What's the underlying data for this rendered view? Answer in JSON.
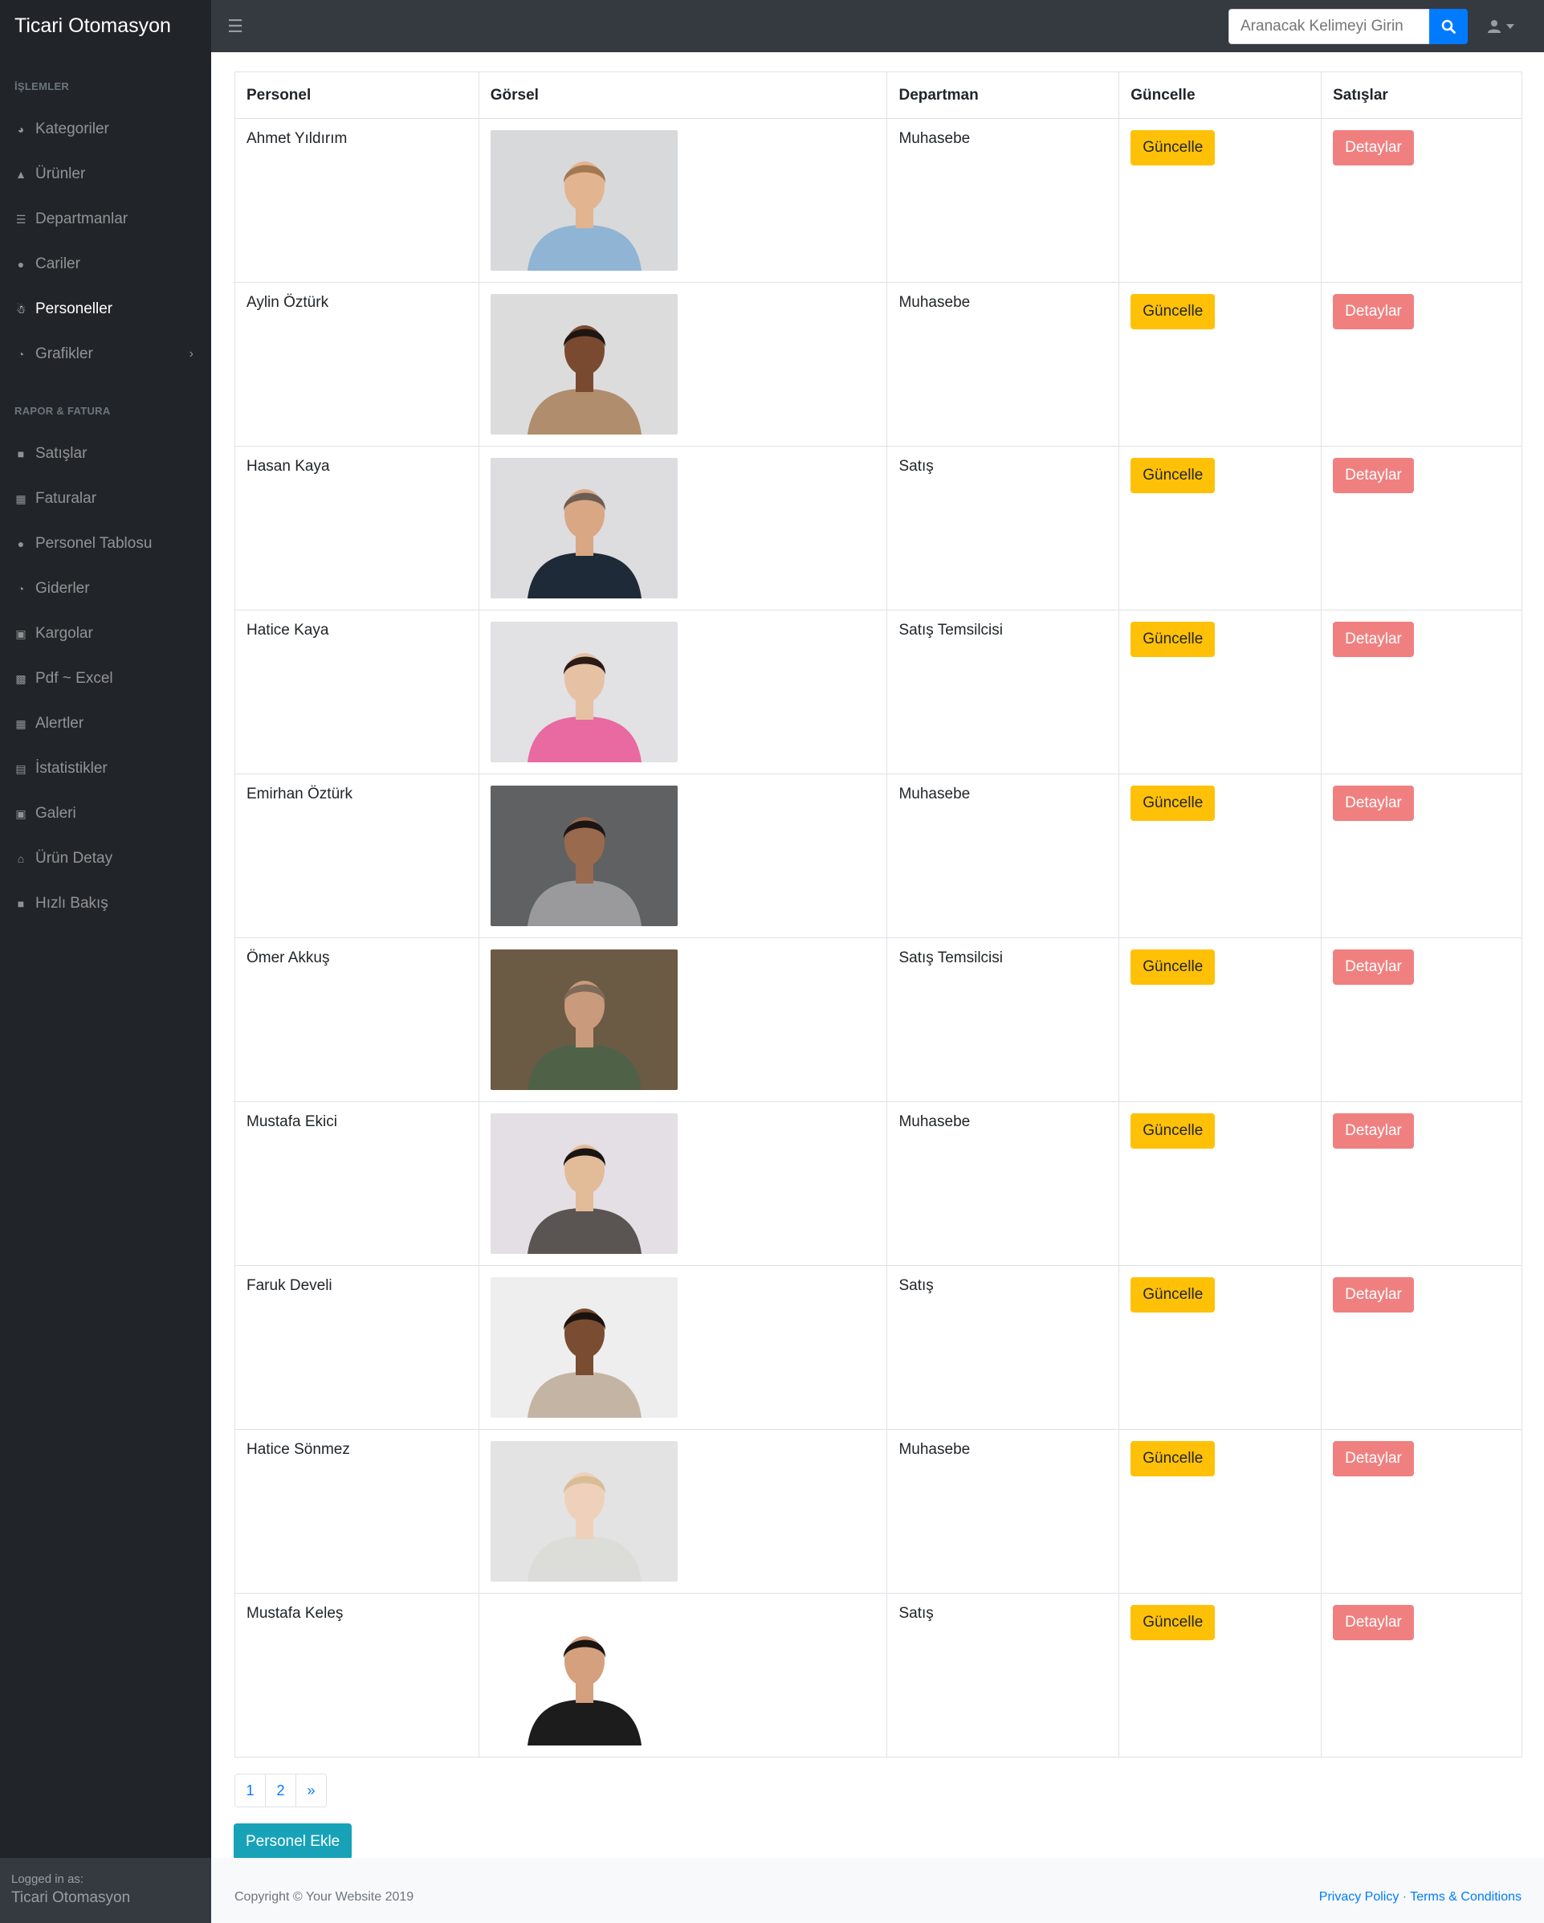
{
  "app": {
    "brand": "Ticari Otomasyon"
  },
  "search": {
    "placeholder": "Aranacak Kelimeyi Girin"
  },
  "sidebar": {
    "headings": [
      "İŞLEMLER",
      "RAPOR & FATURA"
    ],
    "items": [
      {
        "label": "Kategoriler",
        "icon": "tachometer-icon"
      },
      {
        "label": "Ürünler",
        "icon": "flask-icon"
      },
      {
        "label": "Departmanlar",
        "icon": "bars-icon"
      },
      {
        "label": "Cariler",
        "icon": "user-icon"
      },
      {
        "label": "Personeller",
        "icon": "child-icon"
      },
      {
        "label": "Grafikler",
        "icon": "chart-pie-icon"
      }
    ],
    "items2": [
      {
        "label": "Satışlar",
        "icon": "car-icon"
      },
      {
        "label": "Faturalar",
        "icon": "calendar-icon"
      },
      {
        "label": "Personel Tablosu",
        "icon": "users-icon"
      },
      {
        "label": "Giderler",
        "icon": "chart-pie-icon"
      },
      {
        "label": "Kargolar",
        "icon": "gift-icon"
      },
      {
        "label": "Pdf ~ Excel",
        "icon": "print-icon"
      },
      {
        "label": "Alertler",
        "icon": "calendar-icon"
      },
      {
        "label": "İstatistikler",
        "icon": "database-icon"
      },
      {
        "label": "Galeri",
        "icon": "image-icon"
      },
      {
        "label": "Ürün Detay",
        "icon": "university-icon"
      },
      {
        "label": "Hızlı Bakış",
        "icon": "car-icon"
      }
    ],
    "footer": {
      "logged_in_label": "Logged in as:",
      "user": "Ticari Otomasyon"
    }
  },
  "table": {
    "headers": [
      "Personel",
      "Görsel",
      "Departman",
      "Güncelle",
      "Satışlar"
    ],
    "rows": [
      {
        "name": "Ahmet Yıldırım",
        "department": "Muhasebe",
        "update": "Güncelle",
        "details": "Detaylar",
        "bg": "#d8d9db",
        "shirt": "#8fb4d4",
        "skin": "#e2b48f",
        "hair": "#a37752"
      },
      {
        "name": "Aylin Öztürk",
        "department": "Muhasebe",
        "update": "Güncelle",
        "details": "Detaylar",
        "bg": "#dcdcdc",
        "shirt": "#b08d6c",
        "skin": "#7a4a30",
        "hair": "#1e1611"
      },
      {
        "name": "Hasan Kaya",
        "department": "Satış",
        "update": "Güncelle",
        "details": "Detaylar",
        "bg": "#dddcdf",
        "shirt": "#1f2a38",
        "skin": "#d9a784",
        "hair": "#6d5c52"
      },
      {
        "name": "Hatice Kaya",
        "department": "Satış Temsilcisi",
        "update": "Güncelle",
        "details": "Detaylar",
        "bg": "#e2e1e4",
        "shirt": "#e86aa0",
        "skin": "#e7c1a4",
        "hair": "#2b1b16"
      },
      {
        "name": "Emirhan Öztürk",
        "department": "Muhasebe",
        "update": "Güncelle",
        "details": "Detaylar",
        "bg": "#5f6163",
        "shirt": "#9a9a9c",
        "skin": "#9a6a4e",
        "hair": "#1b1614"
      },
      {
        "name": "Ömer Akkuş",
        "department": "Satış Temsilcisi",
        "update": "Güncelle",
        "details": "Detaylar",
        "bg": "#6b5a44",
        "shirt": "#4f6247",
        "skin": "#c99a7b",
        "hair": "#7d6a58"
      },
      {
        "name": "Mustafa Ekici",
        "department": "Muhasebe",
        "update": "Güncelle",
        "details": "Detaylar",
        "bg": "#e4dfe4",
        "shirt": "#5a5452",
        "skin": "#e2bb98",
        "hair": "#1a1514"
      },
      {
        "name": "Faruk Develi",
        "department": "Satış",
        "update": "Güncelle",
        "details": "Detaylar",
        "bg": "#eeeeee",
        "shirt": "#c4b4a4",
        "skin": "#7a4c31",
        "hair": "#1a120e"
      },
      {
        "name": "Hatice Sönmez",
        "department": "Muhasebe",
        "update": "Güncelle",
        "details": "Detaylar",
        "bg": "#e3e3e3",
        "shirt": "#dcdcd8",
        "skin": "#efd1bb",
        "hair": "#d9bd95"
      },
      {
        "name": "Mustafa Keleş",
        "department": "Satış",
        "update": "Güncelle",
        "details": "Detaylar",
        "bg": "#ffffff",
        "shirt": "#1c1c1c",
        "skin": "#d4a07d",
        "hair": "#1b1411"
      }
    ]
  },
  "pagination": [
    "1",
    "2",
    "»"
  ],
  "actions": {
    "add_label": "Personel Ekle"
  },
  "footer": {
    "copyright": "Copyright © Your Website 2019",
    "privacy": "Privacy Policy",
    "separator": "·",
    "terms": "Terms & Conditions"
  },
  "colors": {
    "accent": "#007bff",
    "warning": "#ffc107",
    "danger": "#f08080",
    "info": "#17a2b8",
    "sidebar": "#212529"
  }
}
